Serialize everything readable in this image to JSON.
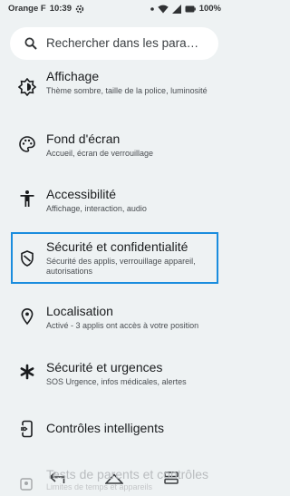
{
  "status_bar": {
    "carrier": "Orange F",
    "time": "10:39",
    "battery": "100%"
  },
  "search": {
    "placeholder": "Rechercher dans les para…"
  },
  "settings": [
    {
      "title": "Affichage",
      "subtitle": "Thème sombre, taille de la police, luminosité",
      "icon": "brightness-icon"
    },
    {
      "title": "Fond d'écran",
      "subtitle": "Accueil, écran de verrouillage",
      "icon": "palette-icon"
    },
    {
      "title": "Accessibilité",
      "subtitle": "Affichage, interaction, audio",
      "icon": "accessibility-icon"
    },
    {
      "title": "Sécurité et confidentialité",
      "subtitle": "Sécurité des applis, verrouillage appareil, autorisations",
      "icon": "shield-icon"
    },
    {
      "title": "Localisation",
      "subtitle": "Activé - 3 applis ont accès à votre position",
      "icon": "location-icon"
    },
    {
      "title": "Sécurité et urgences",
      "subtitle": "SOS Urgence, infos médicales, alertes",
      "icon": "asterisk-icon"
    },
    {
      "title": "Contrôles intelligents",
      "subtitle": "",
      "icon": "smart-controls-icon"
    },
    {
      "title": "Tests de parents et contrôles",
      "subtitle": "Limites de temps et appareils",
      "icon": "person-icon"
    }
  ],
  "colors": {
    "background": "#eef2f3",
    "focus_ring": "#1a8dde"
  }
}
